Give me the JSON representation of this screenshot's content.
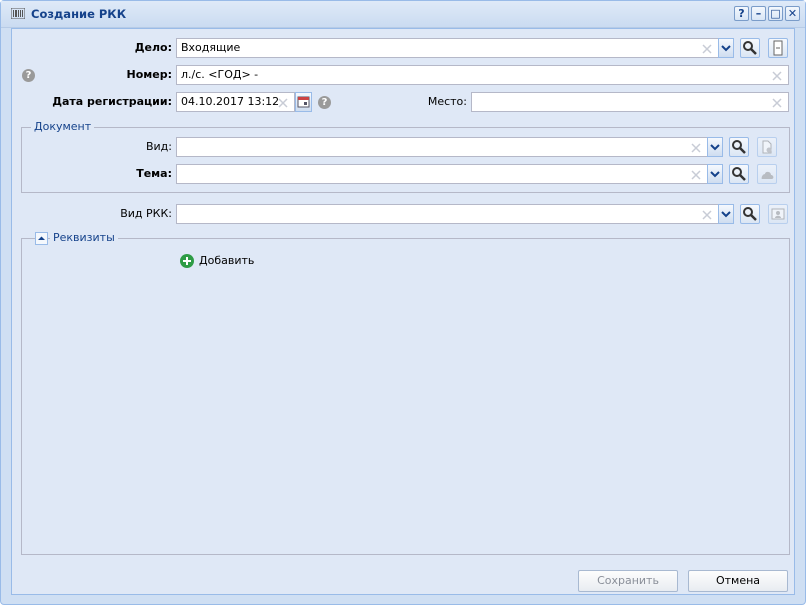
{
  "window": {
    "title": "Создание РКК",
    "controls": {
      "help": "?",
      "minimize": "–",
      "maximize": "□",
      "close": "✕"
    }
  },
  "form": {
    "delo": {
      "label": "Дело:",
      "value": "Входящие"
    },
    "nomer": {
      "label": "Номер:",
      "value": "л./с. <ГОД> -"
    },
    "data_reg": {
      "label": "Дата регистрации:",
      "value": "04.10.2017 13:12"
    },
    "mesto": {
      "label": "Место:",
      "value": ""
    },
    "help_mark": "?"
  },
  "document": {
    "legend": "Документ",
    "vid": {
      "label": "Вид:",
      "value": ""
    },
    "tema": {
      "label": "Тема:",
      "value": ""
    }
  },
  "vid_rkk": {
    "label": "Вид РКК:",
    "value": ""
  },
  "rekvizity": {
    "legend": "Реквизиты",
    "add_label": "Добавить"
  },
  "footer": {
    "save_label": "Сохранить",
    "save_enabled": false,
    "cancel_label": "Отмена"
  },
  "colors": {
    "accent": "#15428b",
    "panel_bg": "#dfe8f6",
    "add_icon": "#2e9c46"
  },
  "icons": [
    "barcode-icon",
    "search-icon",
    "clear-icon",
    "dropdown-arrow-icon",
    "calendar-icon",
    "help-icon",
    "add-icon",
    "collapse-icon"
  ]
}
